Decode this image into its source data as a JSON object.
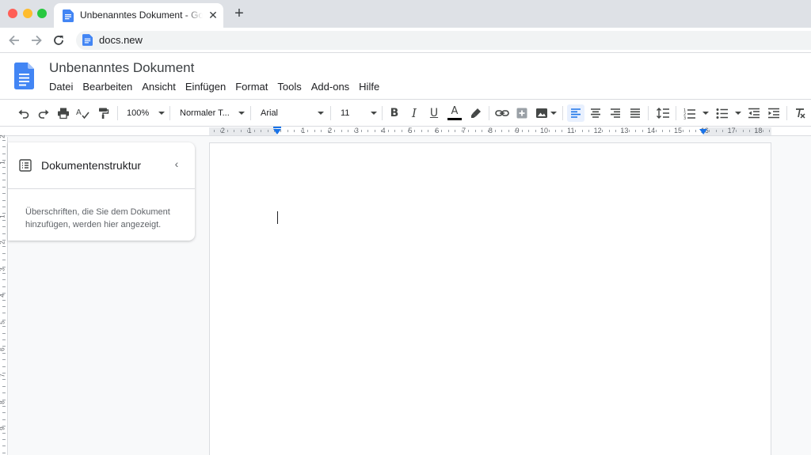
{
  "browser": {
    "tab_title": "Unbenanntes Dokument - Google Docs",
    "tab_close": "✕",
    "new_tab": "+",
    "url": "docs.new"
  },
  "docs": {
    "title": "Unbenanntes Dokument",
    "menu": [
      "Datei",
      "Bearbeiten",
      "Ansicht",
      "Einfügen",
      "Format",
      "Tools",
      "Add-ons",
      "Hilfe"
    ]
  },
  "toolbar": {
    "zoom": "100%",
    "style": "Normaler T...",
    "font": "Arial",
    "font_size": "11",
    "bold": "B",
    "italic": "I",
    "underline": "U",
    "text_color_letter": "A",
    "text_color": "#000000",
    "accent_color": "#1a73e8"
  },
  "ruler": {
    "numbers": [
      "2",
      "1",
      "1",
      "2",
      "3",
      "4",
      "5",
      "6",
      "7",
      "8",
      "9",
      "10",
      "11",
      "12",
      "13",
      "14",
      "15",
      "16",
      "17",
      "18"
    ],
    "vertical_numbers": [
      "2",
      "1",
      "1",
      "2",
      "3",
      "4",
      "5",
      "6",
      "7",
      "8",
      "9"
    ]
  },
  "outline": {
    "title": "Dokumentenstruktur",
    "collapse": "‹",
    "hint": "Überschriften, die Sie dem Dokument hinzufügen, werden hier angezeigt."
  }
}
